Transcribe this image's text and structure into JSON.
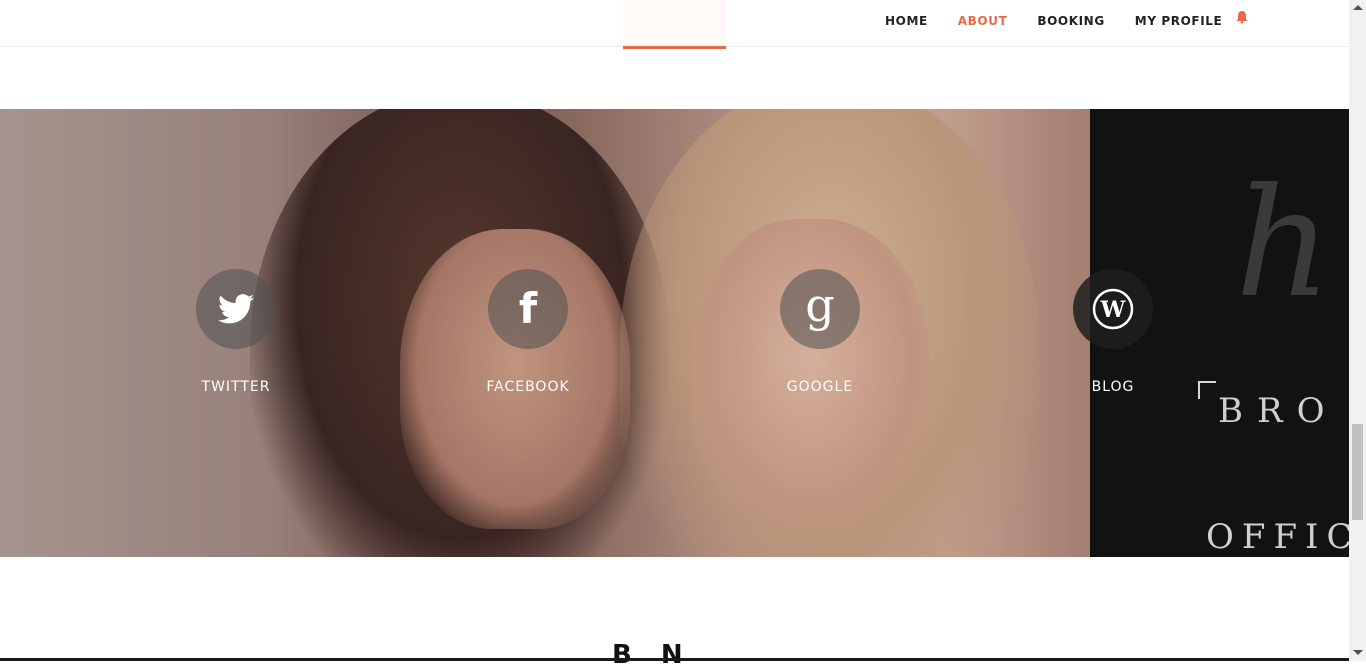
{
  "nav": {
    "items": [
      {
        "label": "HOME",
        "active": false
      },
      {
        "label": "ABOUT",
        "active": true
      },
      {
        "label": "BOOKING",
        "active": false
      },
      {
        "label": "MY PROFILE",
        "active": false
      }
    ],
    "accent_color": "#e96a4a",
    "bell_icon": "bell-icon"
  },
  "social": [
    {
      "label": "TWITTER",
      "icon": "twitter-icon"
    },
    {
      "label": "FACEBOOK",
      "icon": "facebook-icon"
    },
    {
      "label": "GOOGLE",
      "icon": "google-icon"
    },
    {
      "label": "BLOG",
      "icon": "wordpress-icon"
    }
  ],
  "panel": {
    "text_top": "BRO",
    "text_bottom": "OFFIC"
  },
  "bottom_heading": "B N"
}
